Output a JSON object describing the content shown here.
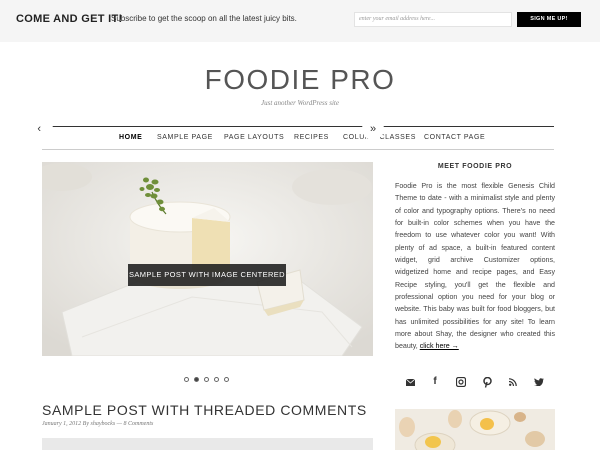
{
  "promo": {
    "title": "COME AND GET IT!",
    "text": "Subscribe to get the scoop on all the latest juicy bits.",
    "email_placeholder": "enter your email address here...",
    "button_label": "SIGN ME UP!"
  },
  "site": {
    "title": "FOODIE PRO",
    "description": "Just another WordPress site"
  },
  "nav": {
    "items": [
      "HOME",
      "SAMPLE PAGE",
      "PAGE LAYOUTS",
      "RECIPES",
      "COLUMN CLASSES",
      "CONTACT PAGE"
    ]
  },
  "slider": {
    "caption": "SAMPLE POST WITH IMAGE CENTERED",
    "prev_label": "‹",
    "next_label": "»",
    "slide_count": 5,
    "active_slide": 2
  },
  "post": {
    "title": "SAMPLE POST WITH THREADED COMMENTS",
    "meta": "January 1, 2012 By shaybocks — 8 Comments"
  },
  "sidebar": {
    "widget_title": "MEET FOODIE PRO",
    "widget_text": "Foodie Pro is the most flexible Genesis Child Theme to date - with a minimalist style and plenty of color and typography options. There's no need for built-in color schemes when you have the freedom to use whatever color you want! With plenty of ad space, a built-in featured content widget, grid archive Customizer options, widgetized home and recipe pages, and Easy Recipe styling, you'll get the flexible and professional option you need for your blog or website. This baby was built for food bloggers, but has unlimited possibilities for any site! To learn more about Shay, the designer who created this beauty,",
    "link_text": "click here →",
    "social_icons": [
      "mail-icon",
      "facebook-icon",
      "instagram-icon",
      "pinterest-icon",
      "rss-icon",
      "twitter-icon"
    ]
  },
  "colors": {
    "background": "#f5f5f5",
    "content": "#ffffff",
    "button": "#000000",
    "text": "#333333"
  }
}
